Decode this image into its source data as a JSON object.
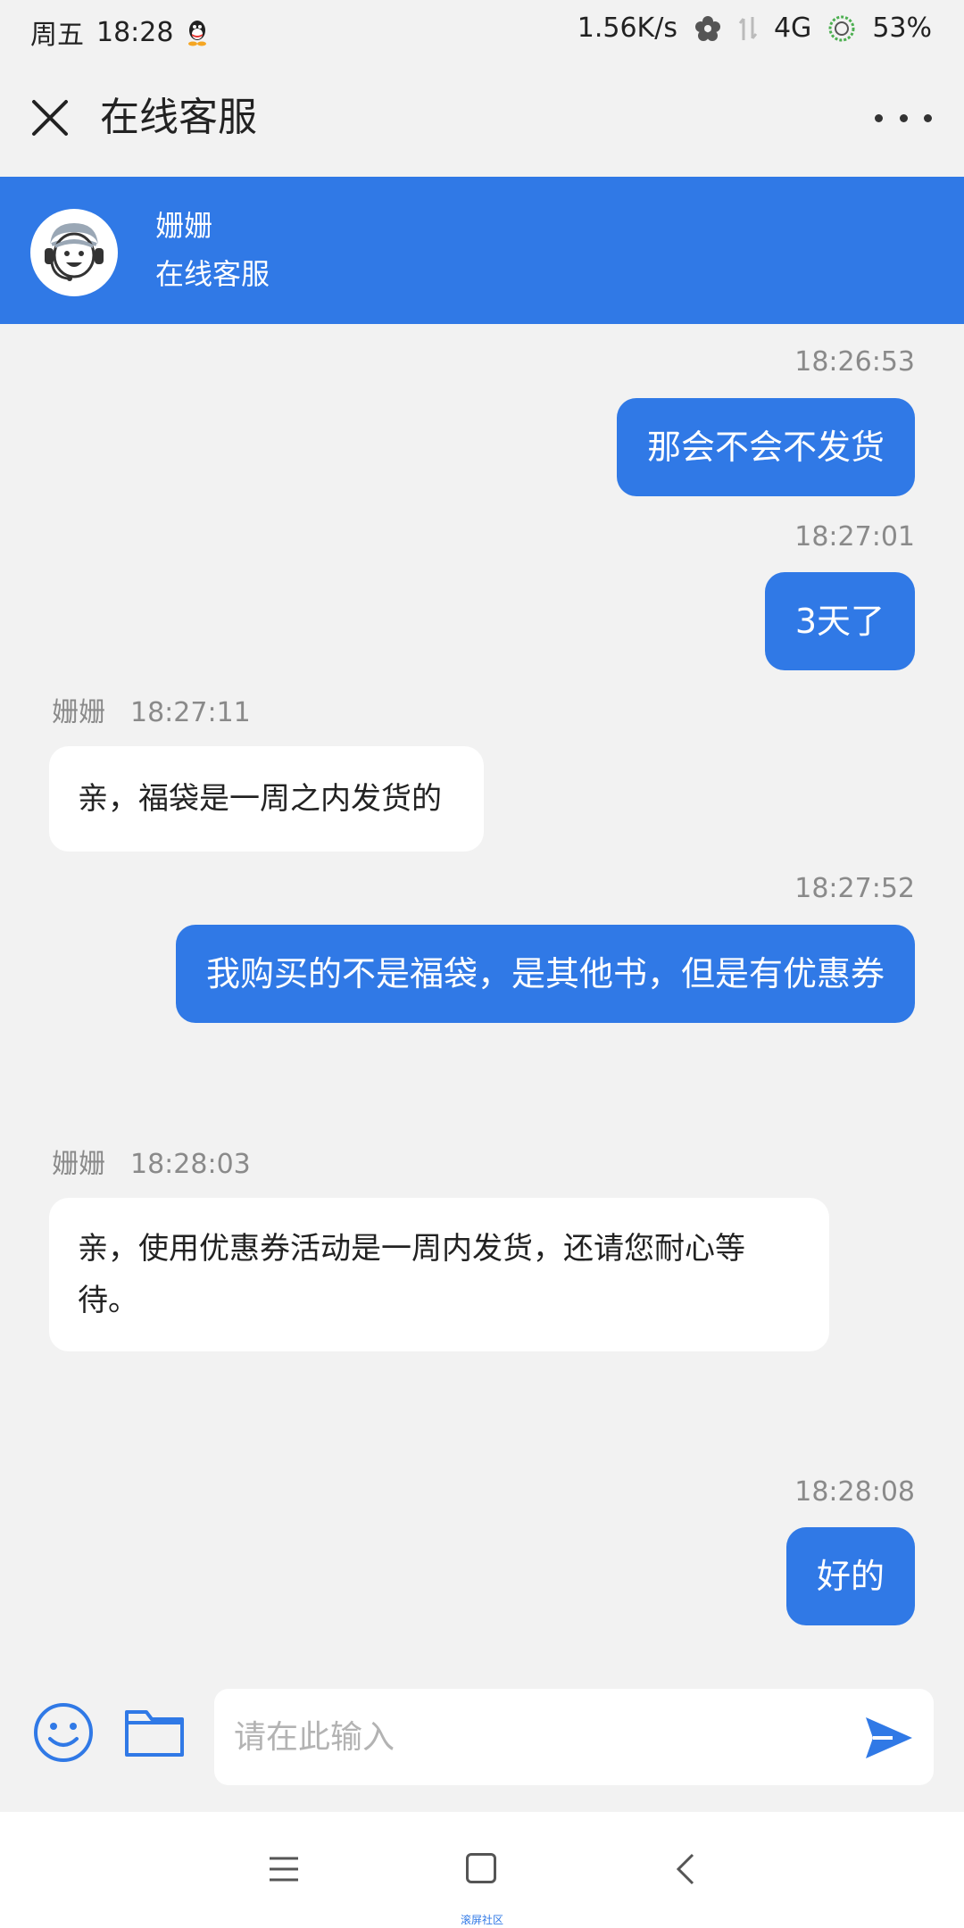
{
  "status_bar": {
    "day": "周五",
    "time": "18:28",
    "net_speed": "1.56K/s",
    "network": "4G",
    "battery": "53%"
  },
  "header": {
    "title": "在线客服"
  },
  "agent": {
    "name": "姗姗",
    "role": "在线客服"
  },
  "messages": [
    {
      "direction": "out",
      "time": "18:26:53",
      "text": "那会不会不发货"
    },
    {
      "direction": "out",
      "time": "18:27:01",
      "text": "3天了"
    },
    {
      "direction": "in",
      "sender": "姗姗",
      "time": "18:27:11",
      "text": "亲，福袋是一周之内发货的"
    },
    {
      "direction": "out",
      "time": "18:27:52",
      "text": "我购买的不是福袋，是其他书，但是有优惠券"
    },
    {
      "direction": "in",
      "sender": "姗姗",
      "time": "18:28:03",
      "text": "亲，使用优惠券活动是一周内发货，还请您耐心等待。"
    },
    {
      "direction": "out",
      "time": "18:28:08",
      "text": "好的"
    }
  ],
  "input": {
    "placeholder": "请在此输入",
    "value": ""
  },
  "icons": {
    "close": "close-icon",
    "more": "more-icon",
    "emoji": "emoji-icon",
    "folder": "folder-icon",
    "send": "send-icon",
    "nav_menu": "menu-icon",
    "nav_home": "home-icon",
    "nav_back": "back-icon"
  },
  "colors": {
    "accent": "#3079e6",
    "background": "#f2f2f2",
    "bubble_in": "#ffffff",
    "timestamp": "#8a8a8a"
  },
  "watermark": "滚屏社区"
}
